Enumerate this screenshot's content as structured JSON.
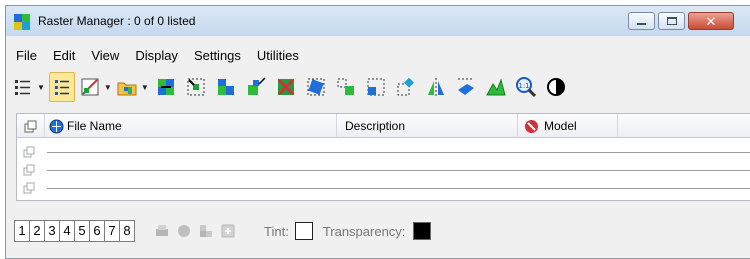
{
  "window": {
    "title": "Raster Manager : 0 of 0 listed",
    "controls": {
      "minimize": "minimize",
      "maximize": "maximize",
      "close": "close"
    }
  },
  "menu": [
    {
      "label": "File"
    },
    {
      "label": "Edit"
    },
    {
      "label": "View"
    },
    {
      "label": "Display"
    },
    {
      "label": "Settings"
    },
    {
      "label": "Utilities"
    }
  ],
  "toolbar": {
    "icons": [
      "list-view-dropdown-icon",
      "detail-list-icon",
      "attach-raster-dropdown-icon",
      "open-folder-dropdown-icon",
      "exchange-icon",
      "select-icon",
      "grid-icon",
      "resize-icon",
      "detach-icon",
      "transform-icon",
      "move-icon",
      "scale-icon",
      "rotate-icon",
      "mirror-icon",
      "warp-icon",
      "chart-icon",
      "zoom-1to1-icon",
      "contrast-icon"
    ]
  },
  "list": {
    "columns": {
      "file_name": "File Name",
      "description": "Description",
      "model": "Model"
    },
    "rows": 3
  },
  "bottom": {
    "views": [
      "1",
      "2",
      "3",
      "4",
      "5",
      "6",
      "7",
      "8"
    ],
    "tint_label": "Tint:",
    "transparency_label": "Transparency:",
    "transparency_color": "#000000",
    "tint_color": "#ffffff"
  },
  "colors": {
    "titlebar": "#dbe8f6",
    "close_button": "#c94b36",
    "active_tool": "#fde89a"
  }
}
